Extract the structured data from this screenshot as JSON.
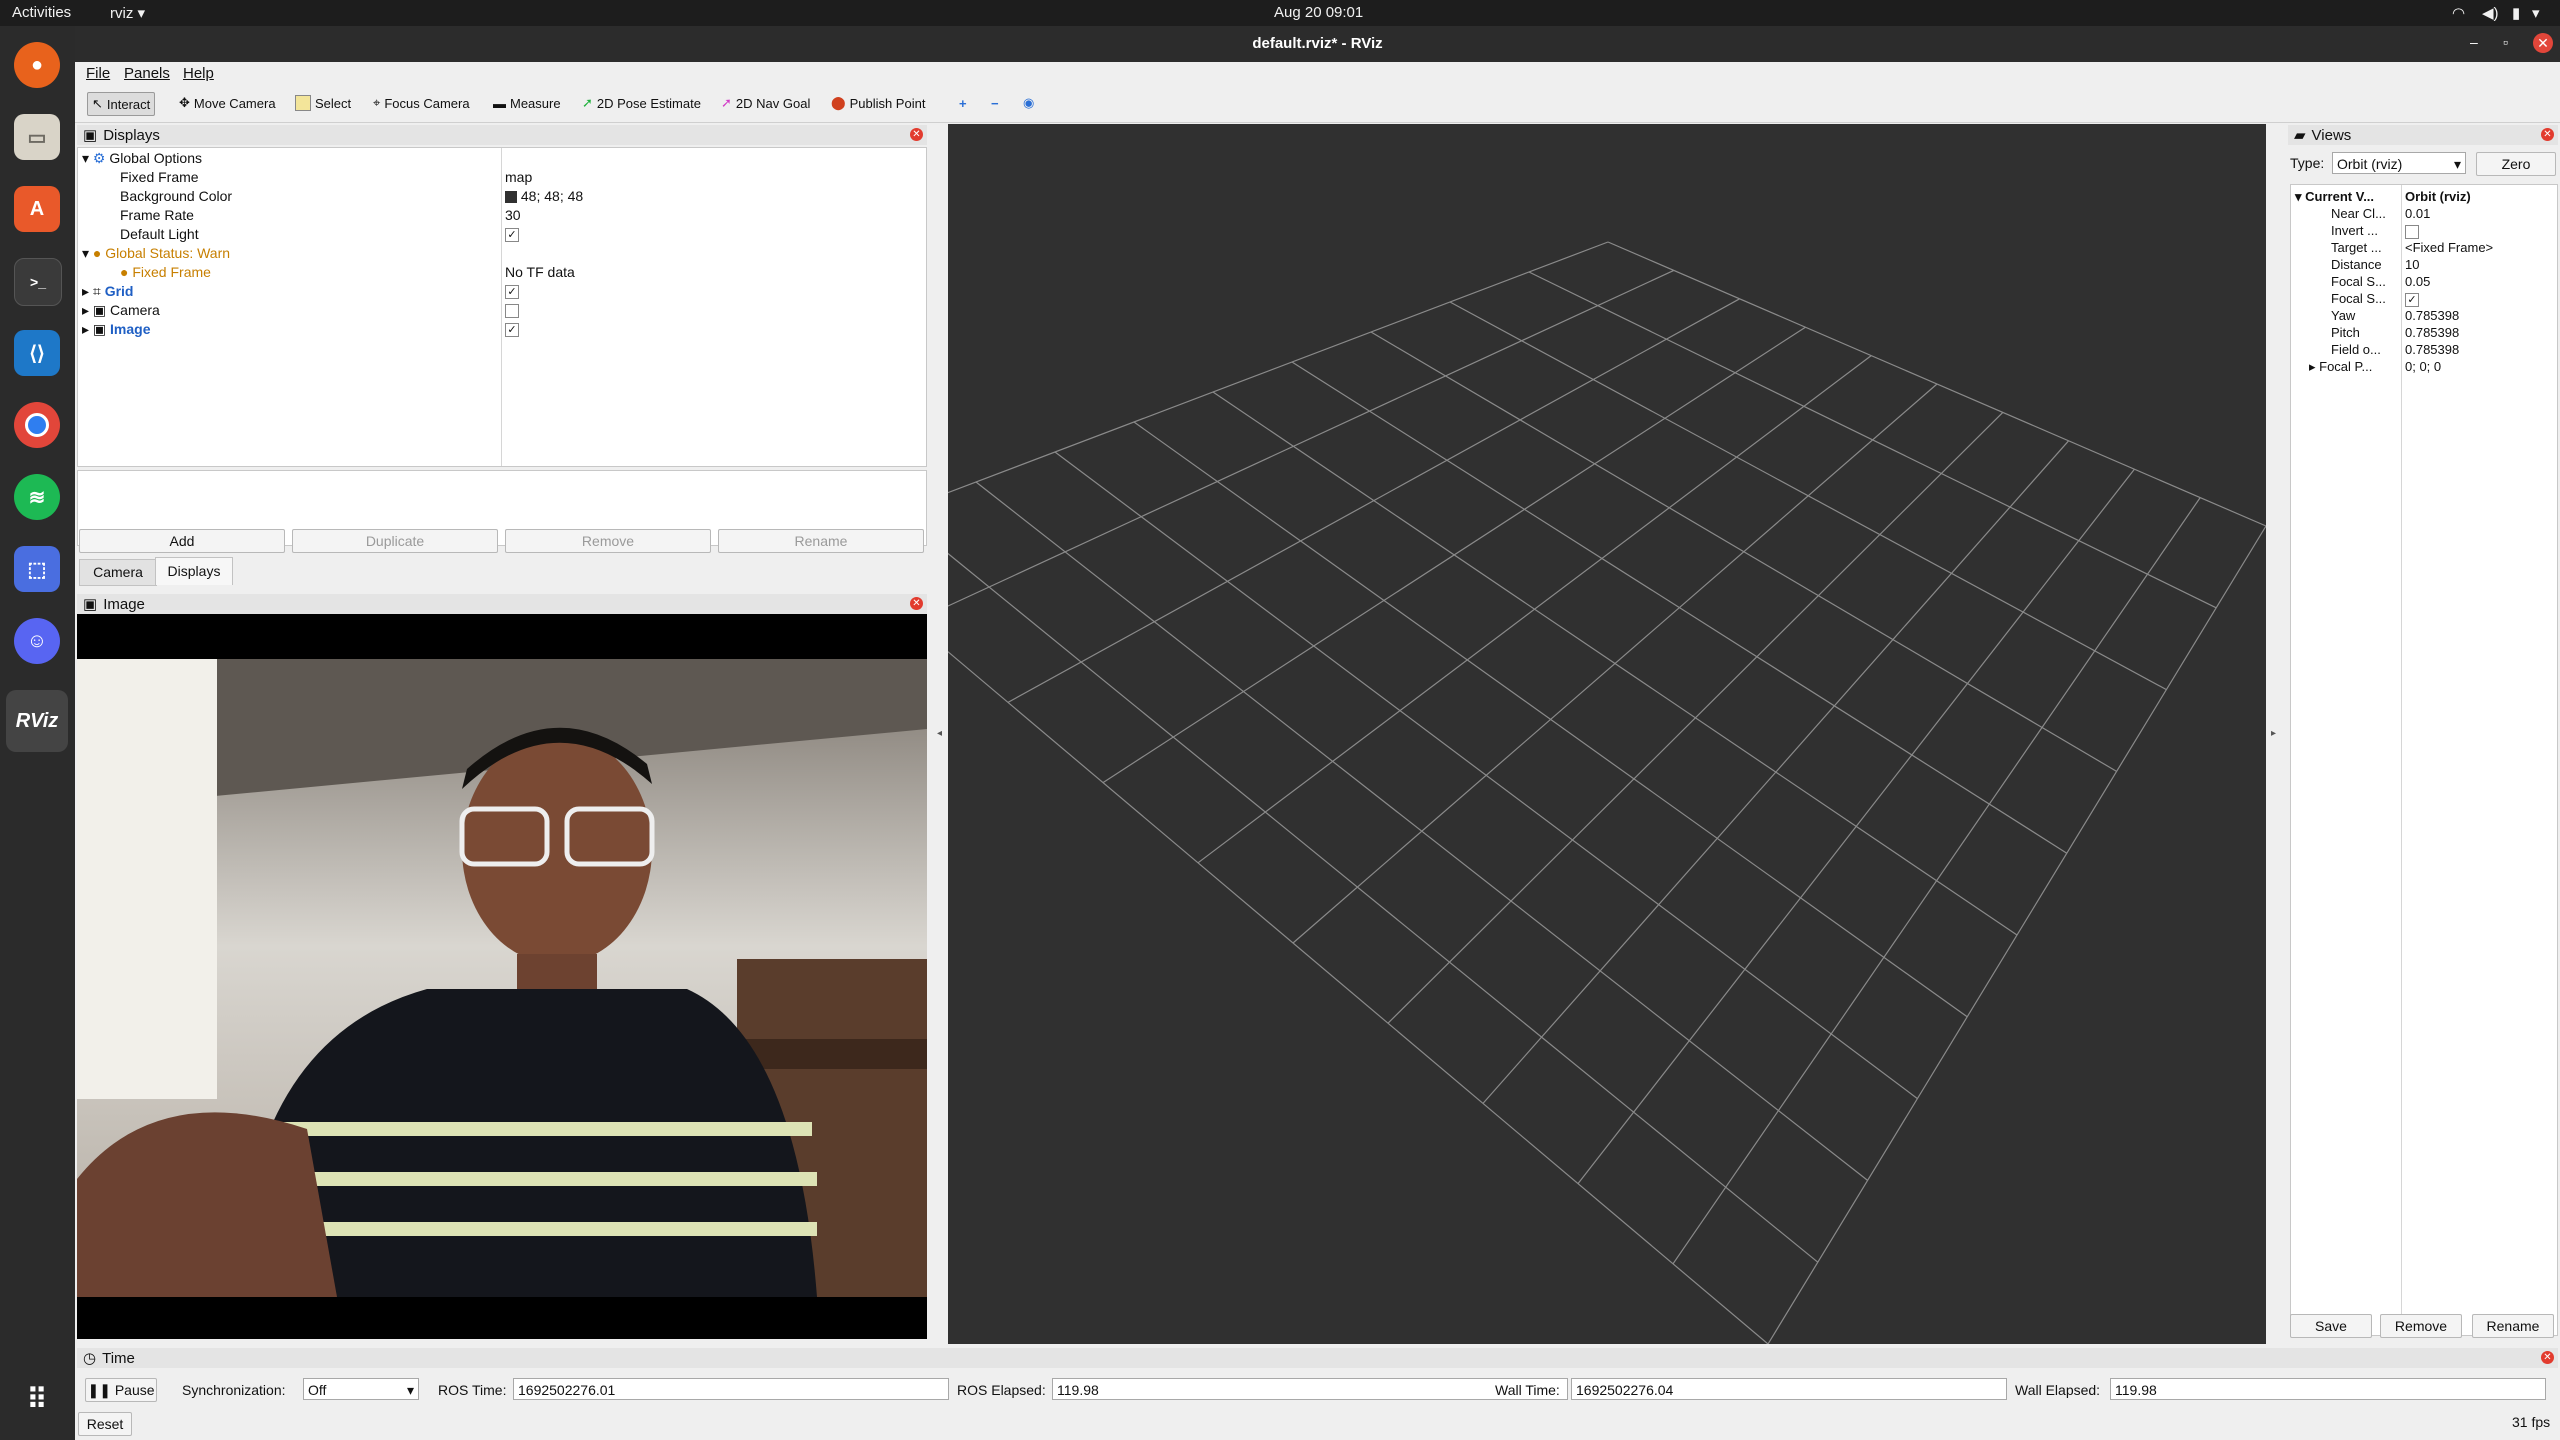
{
  "system_bar": {
    "activities": "Activities",
    "app": "rviz",
    "datetime": "Aug 20  09:01"
  },
  "window": {
    "title": "default.rviz* - RViz"
  },
  "menu": {
    "file": "File",
    "panels": "Panels",
    "help": "Help"
  },
  "toolbar": {
    "interact": "Interact",
    "move_camera": "Move Camera",
    "select": "Select",
    "focus_camera": "Focus Camera",
    "measure": "Measure",
    "pose_estimate": "2D Pose Estimate",
    "nav_goal": "2D Nav Goal",
    "publish_point": "Publish Point"
  },
  "displays": {
    "title": "Displays",
    "global_options": "Global Options",
    "fixed_frame_label": "Fixed Frame",
    "fixed_frame_value": "map",
    "bg_color_label": "Background Color",
    "bg_color_value": "48; 48; 48",
    "frame_rate_label": "Frame Rate",
    "frame_rate_value": "30",
    "default_light_label": "Default Light",
    "global_status": "Global Status: Warn",
    "status_fixed_frame": "Fixed Frame",
    "status_fixed_frame_value": "No TF data",
    "grid": "Grid",
    "camera": "Camera",
    "image": "Image",
    "buttons": {
      "add": "Add",
      "duplicate": "Duplicate",
      "remove": "Remove",
      "rename": "Rename"
    },
    "tabs": {
      "camera": "Camera",
      "displays": "Displays"
    }
  },
  "image_panel": {
    "title": "Image"
  },
  "views": {
    "title": "Views",
    "type_label": "Type:",
    "type_value": "Orbit (rviz)",
    "zero": "Zero",
    "current_view": "Current V...",
    "current_view_value": "Orbit (rviz)",
    "props": [
      {
        "label": "Near Cl...",
        "value": "0.01"
      },
      {
        "label": "Invert ...",
        "value": ""
      },
      {
        "label": "Target ...",
        "value": "<Fixed Frame>"
      },
      {
        "label": "Distance",
        "value": "10"
      },
      {
        "label": "Focal S...",
        "value": "0.05"
      },
      {
        "label": "Focal S...",
        "value": ""
      },
      {
        "label": "Yaw",
        "value": "0.785398"
      },
      {
        "label": "Pitch",
        "value": "0.785398"
      },
      {
        "label": "Field o...",
        "value": "0.785398"
      },
      {
        "label": "Focal P...",
        "value": "0; 0; 0"
      }
    ],
    "buttons": {
      "save": "Save",
      "remove": "Remove",
      "rename": "Rename"
    }
  },
  "time": {
    "title": "Time",
    "pause": "Pause",
    "sync_label": "Synchronization:",
    "sync_value": "Off",
    "ros_time_label": "ROS Time:",
    "ros_time": "1692502276.01",
    "ros_elapsed_label": "ROS Elapsed:",
    "ros_elapsed": "119.98",
    "wall_time_label": "Wall Time:",
    "wall_time": "1692502276.04",
    "wall_elapsed_label": "Wall Elapsed:",
    "wall_elapsed": "119.98",
    "reset": "Reset",
    "fps": "31 fps"
  },
  "colors": {
    "viewport_bg": "#303030",
    "grid_line": "#8a8a8a",
    "dock_bg": "#2b2b2b",
    "warn": "#c77f00"
  }
}
